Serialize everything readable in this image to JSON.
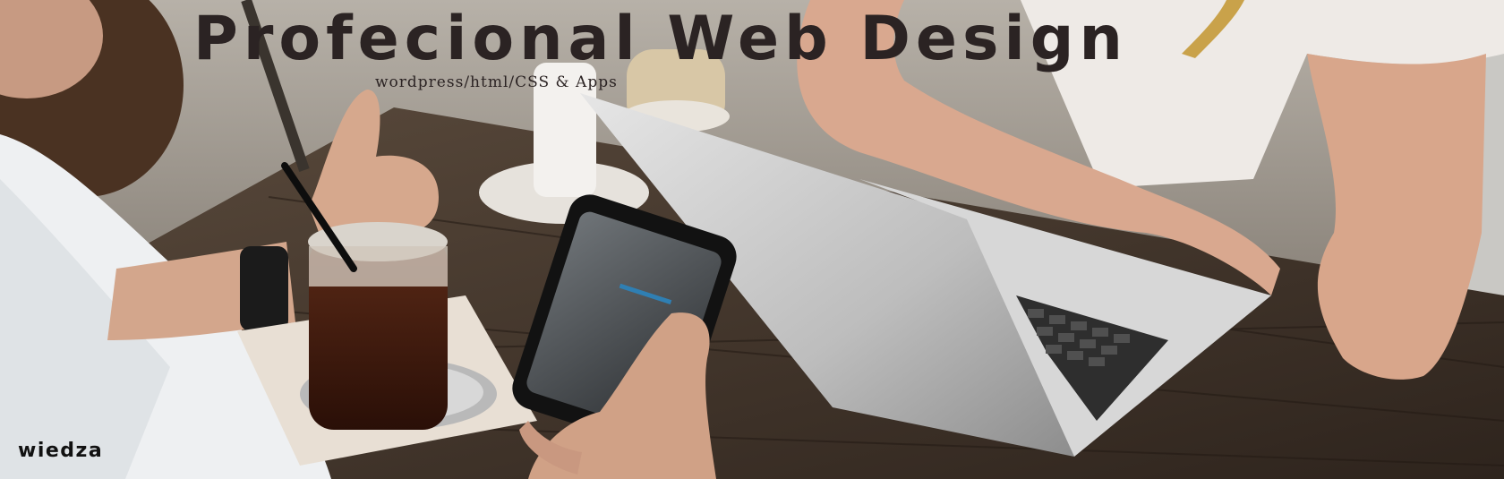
{
  "hero": {
    "headline": "Profecional Web Design",
    "subtitle": "wordpress/html/CSS & Apps",
    "brand": "wiedza"
  },
  "colors": {
    "headline": "#2b2323",
    "brand": "#111111",
    "table": "#3b3028",
    "background": "#8e8a84"
  },
  "image": {
    "description_icon": "cafe-meeting-photo"
  }
}
